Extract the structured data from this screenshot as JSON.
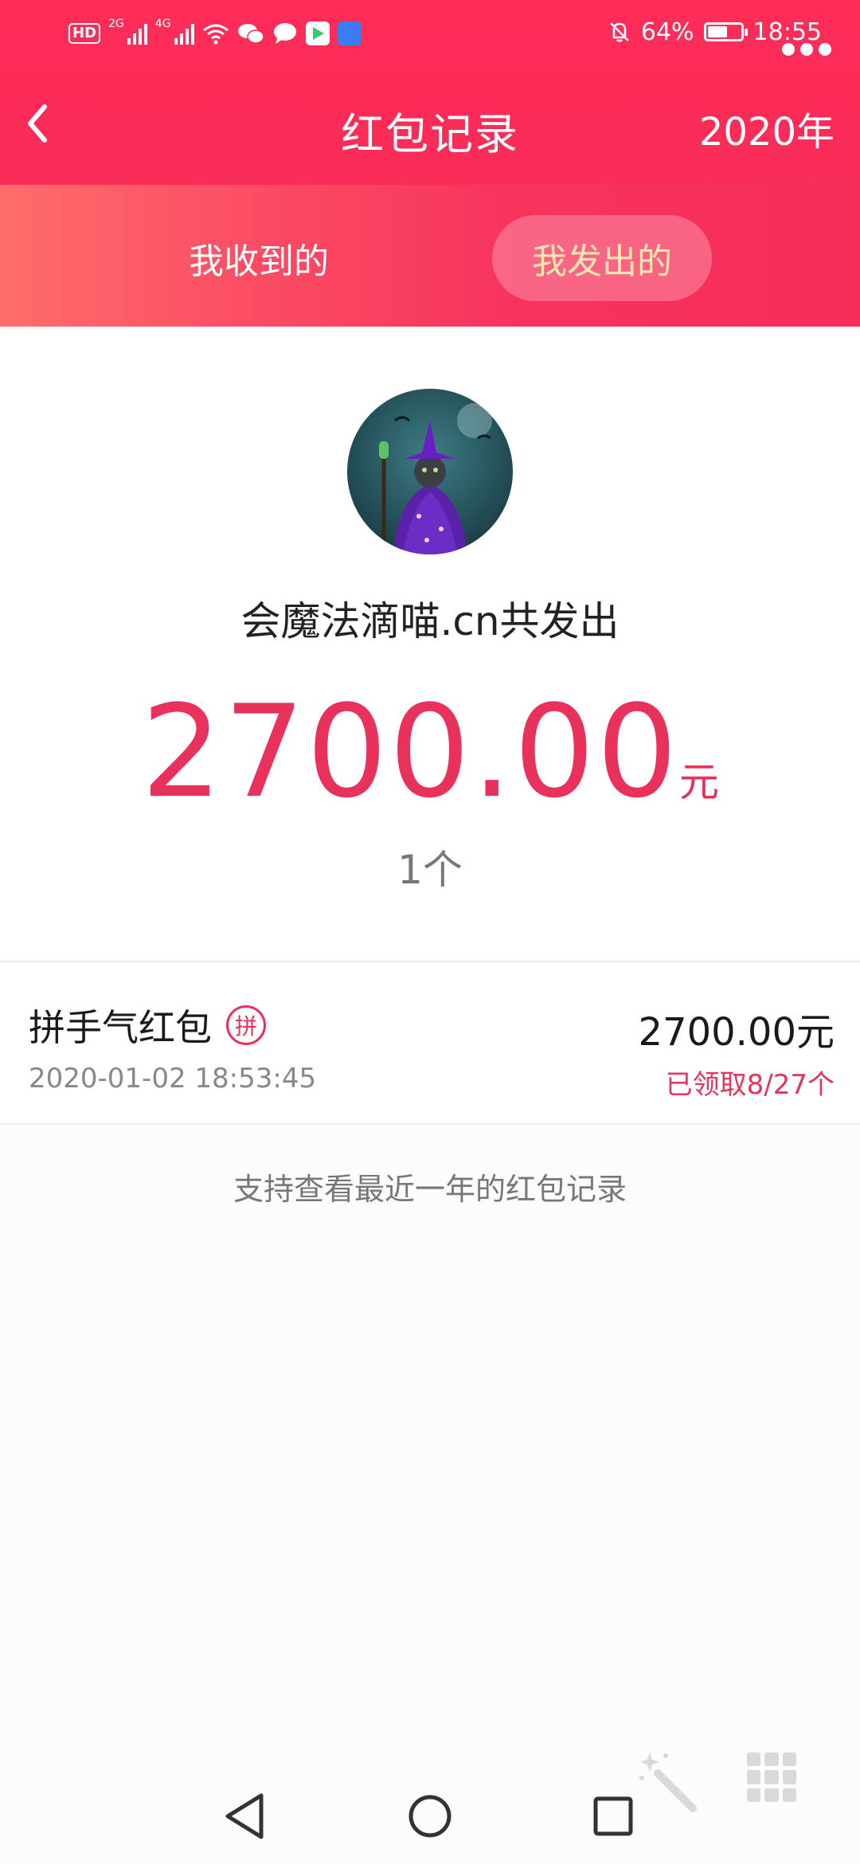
{
  "status_bar": {
    "network_badge": "HD",
    "network_badge_sub": "2",
    "sim1_type": "2G",
    "sim2_type": "4G",
    "battery_percent": "64%",
    "battery_level": 0.64,
    "time": "18:55"
  },
  "header": {
    "title": "红包记录",
    "year_selector": "2020年",
    "back_icon": "chevron-left-icon",
    "more_icon": "more-dots-icon"
  },
  "tabs": {
    "received": "我收到的",
    "sent": "我发出的",
    "active": "sent"
  },
  "summary": {
    "sender_line": "会魔法滴喵.cn共发出",
    "total_amount": "2700.00",
    "currency_unit": "元",
    "count": "1个"
  },
  "records": [
    {
      "type": "拼手气红包",
      "badge": "拼",
      "time": "2020-01-02 18:53:45",
      "amount": "2700.00元",
      "status": "已领取8/27个"
    }
  ],
  "footer_note": "支持查看最近一年的红包记录",
  "colors": {
    "header_red": "#fb2b57",
    "accent_red": "#e8325c",
    "active_tab_text": "#ffe7b0"
  },
  "nav_bar": {
    "back": "triangle-back-icon",
    "home": "circle-home-icon",
    "recents": "square-recents-icon"
  }
}
